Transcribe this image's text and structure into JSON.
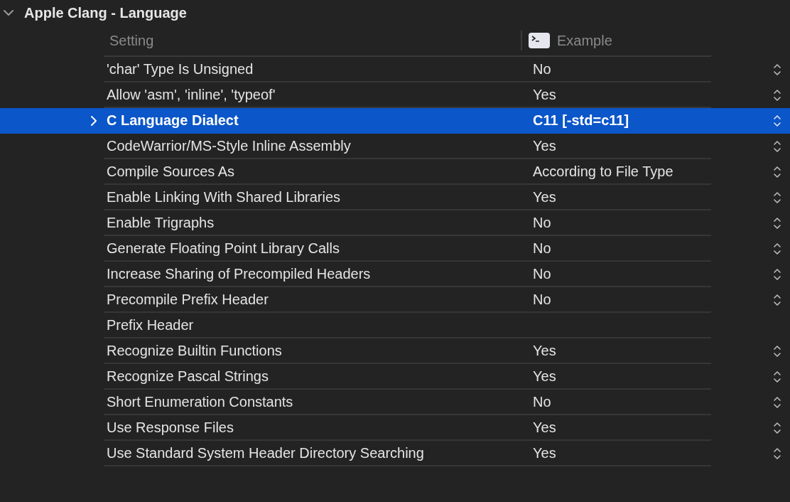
{
  "section": {
    "title": "Apple Clang - Language",
    "expanded": true
  },
  "table": {
    "columns": [
      "Setting",
      "Example"
    ],
    "rows": [
      {
        "setting": "'char' Type Is Unsigned",
        "value": "No",
        "selected": false,
        "expandable": false,
        "stepper": true
      },
      {
        "setting": "Allow 'asm', 'inline', 'typeof'",
        "value": "Yes",
        "selected": false,
        "expandable": false,
        "stepper": true
      },
      {
        "setting": "C Language Dialect",
        "value": "C11 [-std=c11]",
        "selected": true,
        "expandable": true,
        "stepper": true
      },
      {
        "setting": "CodeWarrior/MS-Style Inline Assembly",
        "value": "Yes",
        "selected": false,
        "expandable": false,
        "stepper": true
      },
      {
        "setting": "Compile Sources As",
        "value": "According to File Type",
        "selected": false,
        "expandable": false,
        "stepper": true
      },
      {
        "setting": "Enable Linking With Shared Libraries",
        "value": "Yes",
        "selected": false,
        "expandable": false,
        "stepper": true
      },
      {
        "setting": "Enable Trigraphs",
        "value": "No",
        "selected": false,
        "expandable": false,
        "stepper": true
      },
      {
        "setting": "Generate Floating Point Library Calls",
        "value": "No",
        "selected": false,
        "expandable": false,
        "stepper": true
      },
      {
        "setting": "Increase Sharing of Precompiled Headers",
        "value": "No",
        "selected": false,
        "expandable": false,
        "stepper": true
      },
      {
        "setting": "Precompile Prefix Header",
        "value": "No",
        "selected": false,
        "expandable": false,
        "stepper": true
      },
      {
        "setting": "Prefix Header",
        "selected": false,
        "expandable": false,
        "stepper": false
      },
      {
        "setting": "Recognize Builtin Functions",
        "value": "Yes",
        "selected": false,
        "expandable": false,
        "stepper": true
      },
      {
        "setting": "Recognize Pascal Strings",
        "value": "Yes",
        "selected": false,
        "expandable": false,
        "stepper": true
      },
      {
        "setting": "Short Enumeration Constants",
        "value": "No",
        "selected": false,
        "expandable": false,
        "stepper": true
      },
      {
        "setting": "Use Response Files",
        "value": "Yes",
        "selected": false,
        "expandable": false,
        "stepper": true
      },
      {
        "setting": "Use Standard System Header Directory Searching",
        "value": "Yes",
        "selected": false,
        "expandable": false,
        "stepper": true
      }
    ]
  }
}
